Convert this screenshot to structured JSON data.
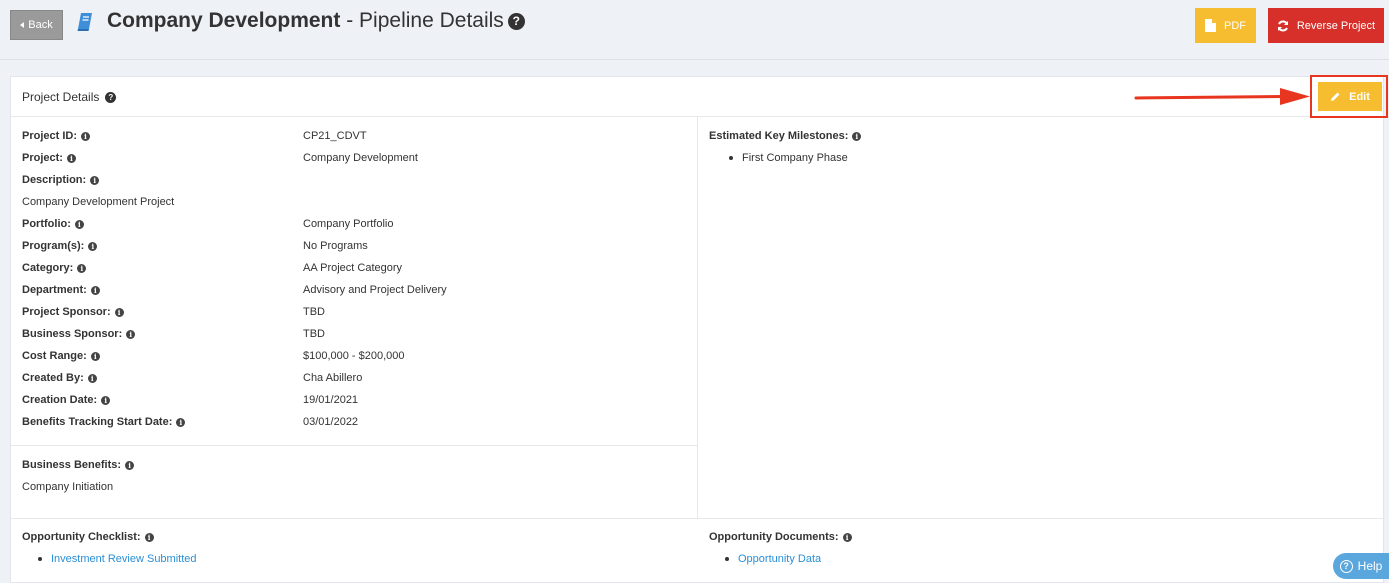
{
  "header": {
    "back_label": "Back",
    "title_bold": "Company Development",
    "title_rest": " - Pipeline Details",
    "pdf_label": "PDF",
    "reverse_label": "Reverse Project"
  },
  "panel": {
    "title": "Project Details",
    "edit_label": "Edit"
  },
  "details": [
    {
      "label": "Project ID:",
      "value": "CP21_CDVT"
    },
    {
      "label": "Project:",
      "value": "Company Development"
    },
    {
      "label": "Description:",
      "value": ""
    },
    {
      "label": "Portfolio:",
      "value": "Company Portfolio"
    },
    {
      "label": "Program(s):",
      "value": "No Programs"
    },
    {
      "label": "Category:",
      "value": "AA Project Category"
    },
    {
      "label": "Department:",
      "value": "Advisory and Project Delivery"
    },
    {
      "label": "Project Sponsor:",
      "value": "TBD"
    },
    {
      "label": "Business Sponsor:",
      "value": "TBD"
    },
    {
      "label": "Cost Range:",
      "value": "$100,000 - $200,000"
    },
    {
      "label": "Created By:",
      "value": "Cha Abillero"
    },
    {
      "label": "Creation Date:",
      "value": "19/01/2021"
    },
    {
      "label": "Benefits Tracking Start Date:",
      "value": "03/01/2022"
    }
  ],
  "description_text": "Company Development Project",
  "business_benefits": {
    "label": "Business Benefits:",
    "text": "Company Initiation"
  },
  "milestones": {
    "label": "Estimated Key Milestones:",
    "items": [
      "First Company Phase"
    ]
  },
  "checklist": {
    "label": "Opportunity Checklist:",
    "items": [
      "Investment Review Submitted"
    ]
  },
  "documents": {
    "label": "Opportunity Documents:",
    "items": [
      "Opportunity Data"
    ]
  },
  "help_label": "Help",
  "colors": {
    "accent_yellow": "#f5bd2f",
    "accent_red": "#d7302b",
    "link_blue": "#2a8fd6",
    "annotation_red": "#e8351f"
  }
}
